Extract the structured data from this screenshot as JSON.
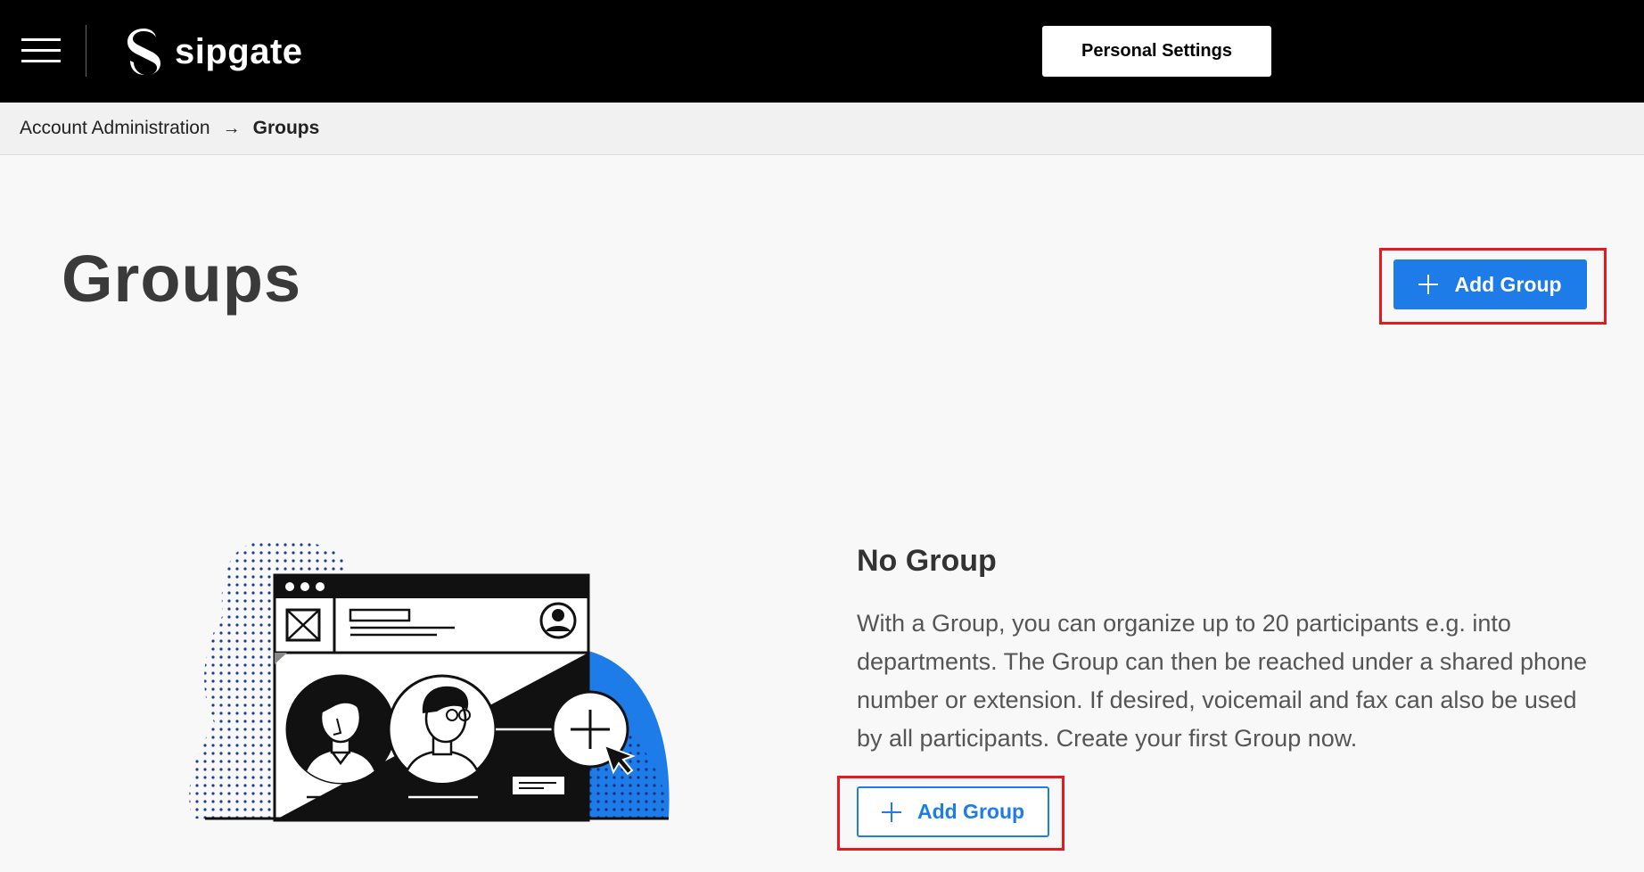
{
  "header": {
    "menu_icon": "hamburger-icon",
    "logo_icon": "sipgate-logo-icon",
    "logo_text": "sipgate",
    "personal_settings_label": "Personal Settings"
  },
  "breadcrumb": {
    "parent": "Account Administration",
    "separator": "→",
    "current": "Groups"
  },
  "page": {
    "title": "Groups",
    "add_group_label": "Add Group"
  },
  "empty_state": {
    "illustration": "groups-illustration",
    "title": "No Group",
    "description": "With a Group, you can organize up to 20 participants e.g. into departments. The Group can then be reached under a shared phone number or extension. If desired, voicemail and fax can also be used by all participants. Create your first Group now.",
    "add_group_label": "Add Group"
  },
  "colors": {
    "primary": "#1d7ce8",
    "header_bg": "#000000",
    "highlight": "#e5191f"
  }
}
